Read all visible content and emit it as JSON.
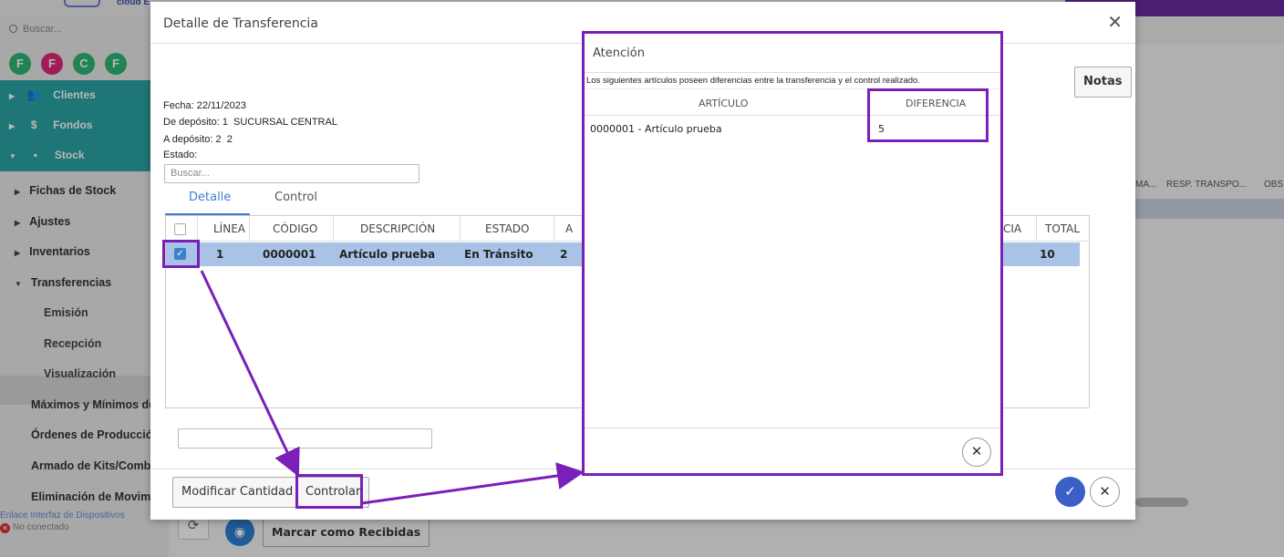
{
  "background": {
    "logo_text": "cloud E",
    "sidebar_search_placeholder": "Buscar...",
    "circles": [
      {
        "letter": "F",
        "color": "#2bb673"
      },
      {
        "letter": "F",
        "color": "#e0297a"
      },
      {
        "letter": "C",
        "color": "#2bb673"
      },
      {
        "letter": "F",
        "color": "#2bb673"
      }
    ],
    "menu": {
      "clientes": "Clientes",
      "fondos": "Fondos",
      "stock": "Stock",
      "fichas": "Fichas de Stock",
      "ajustes": "Ajustes",
      "inventarios": "Inventarios",
      "transferencias": "Transferencias",
      "emision": "Emisión",
      "recepcion": "Recepción",
      "visualizacion": "Visualización",
      "maximos": "Máximos y Mínimos de",
      "ordenes": "Órdenes de Producción",
      "armado": "Armado de Kits/Comb",
      "eliminacion": "Eliminación de Movimi"
    },
    "status_link": "Enlace Interfaz de Dispositivos",
    "status_text": "No conectado",
    "right_headers": [
      "MA...",
      "RESP. TRANSPO...",
      "OBS"
    ],
    "marcar_recibidas": "Marcar como Recibidas"
  },
  "dialog": {
    "title": "Detalle de Transferencia",
    "fecha_label": "Fecha:",
    "fecha_value": "22/11/2023",
    "de_deposito_label": "De depósito:",
    "de_deposito_value": "1  SUCURSAL CENTRAL",
    "a_deposito_label": "A depósito:",
    "a_deposito_value": "2  2",
    "estado_label": "Estado:",
    "search_placeholder": "Buscar...",
    "tabs": [
      "Detalle",
      "Control"
    ],
    "notas": "Notas",
    "columns": {
      "linea": "LÍNEA",
      "codigo": "CÓDIGO",
      "descripcion": "DESCRIPCIÓN",
      "estado": "ESTADO",
      "a": "A",
      "cia": "CIA",
      "total": "TOTAL"
    },
    "row": {
      "linea": "1",
      "codigo": "0000001",
      "descripcion": "Artículo prueba",
      "estado": "En Tránsito",
      "a": "2",
      "total": "10"
    },
    "modificar": "Modificar Cantidad",
    "controlar": "Controlar"
  },
  "attention": {
    "title": "Atención",
    "message": "Los siguientes artículos poseen diferencias entre la transferencia y el control realizado.",
    "col_articulo": "ARTÍCULO",
    "col_diferencia": "DIFERENCIA",
    "articulo": "0000001 - Artículo prueba",
    "diferencia": "5"
  },
  "colors": {
    "accent": "#3f7fd0",
    "annotation": "#7a1fb8",
    "teal": "#2aa4a4"
  }
}
